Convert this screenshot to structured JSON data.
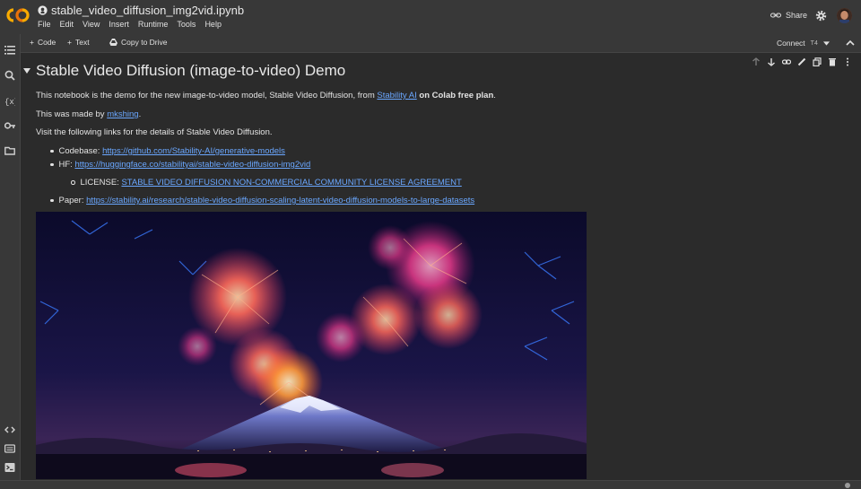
{
  "header": {
    "file_name": "stable_video_diffusion_img2vid.ipynb",
    "menu": [
      "File",
      "Edit",
      "View",
      "Insert",
      "Runtime",
      "Tools",
      "Help"
    ],
    "share_label": "Share"
  },
  "toolbar": {
    "code_label": "Code",
    "text_label": "Text",
    "copy_label": "Copy to Drive",
    "connect_label": "Connect",
    "runtime_label": "T4"
  },
  "notebook": {
    "title": "Stable Video Diffusion (image-to-video) Demo",
    "intro_prefix": "This notebook is the demo for the new image-to-video model, Stable Video Diffusion, from ",
    "intro_link": "Stability AI",
    "intro_bold": "on Colab free plan",
    "intro_suffix": ".",
    "author_prefix": "This was made by ",
    "author_link": "mkshing",
    "author_suffix": ".",
    "visit_text": "Visit the following links for the details of Stable Video Diffusion.",
    "links": {
      "codebase_label": "Codebase: ",
      "codebase_url": "https://github.com/Stability-AI/generative-models",
      "hf_label": "HF: ",
      "hf_url": "https://huggingface.co/stabilityai/stable-video-diffusion-img2vid",
      "license_label": "LICENSE: ",
      "license_text": "STABLE VIDEO DIFFUSION NON-COMMERCIAL COMMUNITY LICENSE AGREEMENT",
      "paper_label": "Paper: ",
      "paper_url": "https://stability.ai/research/stable-video-diffusion-scaling-latent-video-diffusion-models-to-large-datasets"
    }
  },
  "colors": {
    "link": "#6aa7ff",
    "accent_orange": "#f9ab00",
    "background": "#2b2b2b",
    "chrome": "#383838"
  }
}
